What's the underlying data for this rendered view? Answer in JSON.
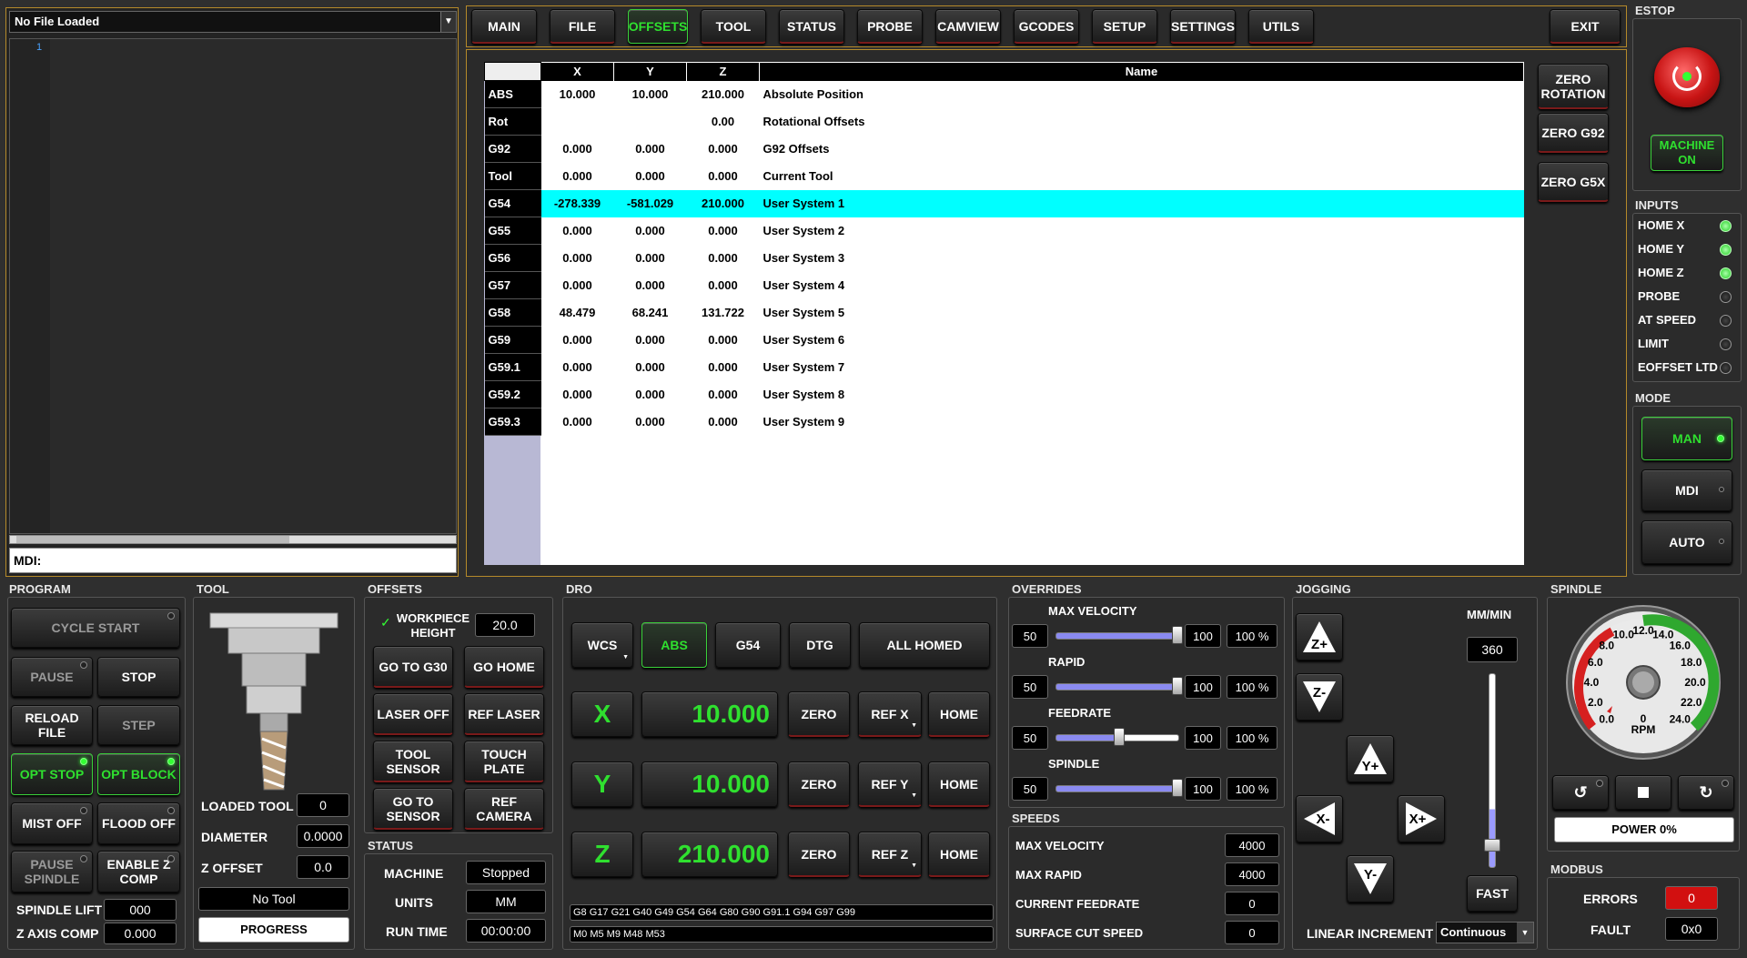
{
  "file": {
    "name": "No File Loaded",
    "line": "1",
    "mdi_label": "MDI:"
  },
  "tabs": [
    "MAIN",
    "FILE",
    "OFFSETS",
    "TOOL",
    "STATUS",
    "PROBE",
    "CAMVIEW",
    "GCODES",
    "SETUP",
    "SETTINGS",
    "UTILS"
  ],
  "active_tab": "OFFSETS",
  "exit_label": "EXIT",
  "offsets_table": {
    "headers": [
      "X",
      "Y",
      "Z",
      "Name"
    ],
    "rows": [
      [
        "ABS",
        "10.000",
        "10.000",
        "210.000",
        "Absolute Position"
      ],
      [
        "Rot",
        "",
        "",
        "0.00",
        "Rotational Offsets"
      ],
      [
        "G92",
        "0.000",
        "0.000",
        "0.000",
        "G92 Offsets"
      ],
      [
        "Tool",
        "0.000",
        "0.000",
        "0.000",
        "Current Tool"
      ],
      [
        "G54",
        "-278.339",
        "-581.029",
        "210.000",
        "User System 1"
      ],
      [
        "G55",
        "0.000",
        "0.000",
        "0.000",
        "User System 2"
      ],
      [
        "G56",
        "0.000",
        "0.000",
        "0.000",
        "User System 3"
      ],
      [
        "G57",
        "0.000",
        "0.000",
        "0.000",
        "User System 4"
      ],
      [
        "G58",
        "48.479",
        "68.241",
        "131.722",
        "User System 5"
      ],
      [
        "G59",
        "0.000",
        "0.000",
        "0.000",
        "User System 6"
      ],
      [
        "G59.1",
        "0.000",
        "0.000",
        "0.000",
        "User System 7"
      ],
      [
        "G59.2",
        "0.000",
        "0.000",
        "0.000",
        "User System 8"
      ],
      [
        "G59.3",
        "0.000",
        "0.000",
        "0.000",
        "User System 9"
      ]
    ],
    "selected_row": 4,
    "highlight_color": "#00ffff"
  },
  "offset_buttons": {
    "zero_rotation": "ZERO ROTATION",
    "zero_g92": "ZERO G92",
    "zero_g5x": "ZERO G5X"
  },
  "estop": {
    "label": "ESTOP",
    "machine_on": "MACHINE ON"
  },
  "inputs": {
    "label": "INPUTS",
    "items": [
      {
        "name": "HOME X",
        "on": true
      },
      {
        "name": "HOME Y",
        "on": true
      },
      {
        "name": "HOME Z",
        "on": true
      },
      {
        "name": "PROBE",
        "on": false
      },
      {
        "name": "AT SPEED",
        "on": false
      },
      {
        "name": "LIMIT",
        "on": false
      },
      {
        "name": "EOFFSET LTD",
        "on": false
      }
    ]
  },
  "mode": {
    "label": "MODE",
    "man": "MAN",
    "mdi": "MDI",
    "auto": "AUTO"
  },
  "program": {
    "label": "PROGRAM",
    "cycle_start": "CYCLE START",
    "pause": "PAUSE",
    "stop": "STOP",
    "reload": "RELOAD FILE",
    "step": "STEP",
    "opt_stop": "OPT STOP",
    "opt_block": "OPT BLOCK",
    "mist": "MIST OFF",
    "flood": "FLOOD OFF",
    "pause_spindle": "PAUSE SPINDLE",
    "enable_zcomp": "ENABLE Z COMP",
    "spindle_lift_label": "SPINDLE LIFT",
    "spindle_lift": "000",
    "z_axis_comp_label": "Z AXIS COMP",
    "z_axis_comp": "0.000"
  },
  "tool": {
    "label": "TOOL",
    "loaded_tool_label": "LOADED TOOL",
    "loaded_tool": "0",
    "diameter_label": "DIAMETER",
    "diameter": "0.0000",
    "z_offset_label": "Z OFFSET",
    "z_offset": "0.0",
    "tool_name": "No Tool",
    "progress": "PROGRESS"
  },
  "offsets": {
    "label": "OFFSETS",
    "workpiece_height_label": "WORKPIECE HEIGHT",
    "workpiece_height": "20.0",
    "check": "✓",
    "go_g30": "GO TO G30",
    "go_home": "GO HOME",
    "laser_off": "LASER OFF",
    "ref_laser": "REF LASER",
    "tool_sensor": "TOOL SENSOR",
    "touch_plate": "TOUCH PLATE",
    "go_sensor": "GO TO SENSOR",
    "ref_camera": "REF CAMERA"
  },
  "status": {
    "label": "STATUS",
    "machine_label": "MACHINE",
    "machine": "Stopped",
    "units_label": "UNITS",
    "units": "MM",
    "run_time_label": "RUN TIME",
    "run_time": "00:00:00"
  },
  "dro": {
    "label": "DRO",
    "wcs": "WCS",
    "abs": "ABS",
    "g54": "G54",
    "dtg": "DTG",
    "all_homed": "ALL HOMED",
    "axes": [
      {
        "axis": "X",
        "value": "10.000",
        "ref": "REF X"
      },
      {
        "axis": "Y",
        "value": "10.000",
        "ref": "REF Y"
      },
      {
        "axis": "Z",
        "value": "210.000",
        "ref": "REF Z"
      }
    ],
    "zero": "ZERO",
    "home": "HOME",
    "gcodes": "G8 G17 G21 G40 G49 G54 G64 G80 G90 G91.1 G94 G97 G99",
    "mcodes": "M0 M5 M9 M48 M53"
  },
  "overrides": {
    "label": "OVERRIDES",
    "items": [
      {
        "name": "MAX VELOCITY",
        "min": "50",
        "max": "100",
        "pct": "100 %",
        "level": 1.0
      },
      {
        "name": "RAPID",
        "min": "50",
        "max": "100",
        "pct": "100 %",
        "level": 1.0
      },
      {
        "name": "FEEDRATE",
        "min": "50",
        "max": "100",
        "pct": "100 %",
        "level": 0.5
      },
      {
        "name": "SPINDLE",
        "min": "50",
        "max": "100",
        "pct": "100 %",
        "level": 1.0
      }
    ]
  },
  "speeds": {
    "label": "SPEEDS",
    "items": [
      {
        "name": "MAX VELOCITY",
        "value": "4000"
      },
      {
        "name": "MAX RAPID",
        "value": "4000"
      },
      {
        "name": "CURRENT FEEDRATE",
        "value": "0"
      },
      {
        "name": "SURFACE CUT SPEED",
        "value": "0"
      }
    ]
  },
  "jogging": {
    "label": "JOGGING",
    "units": "MM/MIN",
    "rate": "360",
    "fast": "FAST",
    "linear_increment_label": "LINEAR INCREMENT",
    "linear_increment": "Continuous",
    "zplus": "Z+",
    "zminus": "Z-",
    "yplus": "Y+",
    "yminus": "Y-",
    "xplus": "X+",
    "xminus": "X-"
  },
  "spindle": {
    "label": "SPINDLE",
    "rpm_label": "RPM",
    "rpm": "0",
    "ticks": [
      "0.0",
      "2.0",
      "4.0",
      "6.0",
      "8.0",
      "10.0",
      "12.0",
      "14.0",
      "16.0",
      "18.0",
      "20.0",
      "22.0",
      "24.0"
    ],
    "power": "POWER 0%"
  },
  "modbus": {
    "label": "MODBUS",
    "errors_label": "ERRORS",
    "errors": "0",
    "fault_label": "FAULT",
    "fault": "0x0"
  }
}
